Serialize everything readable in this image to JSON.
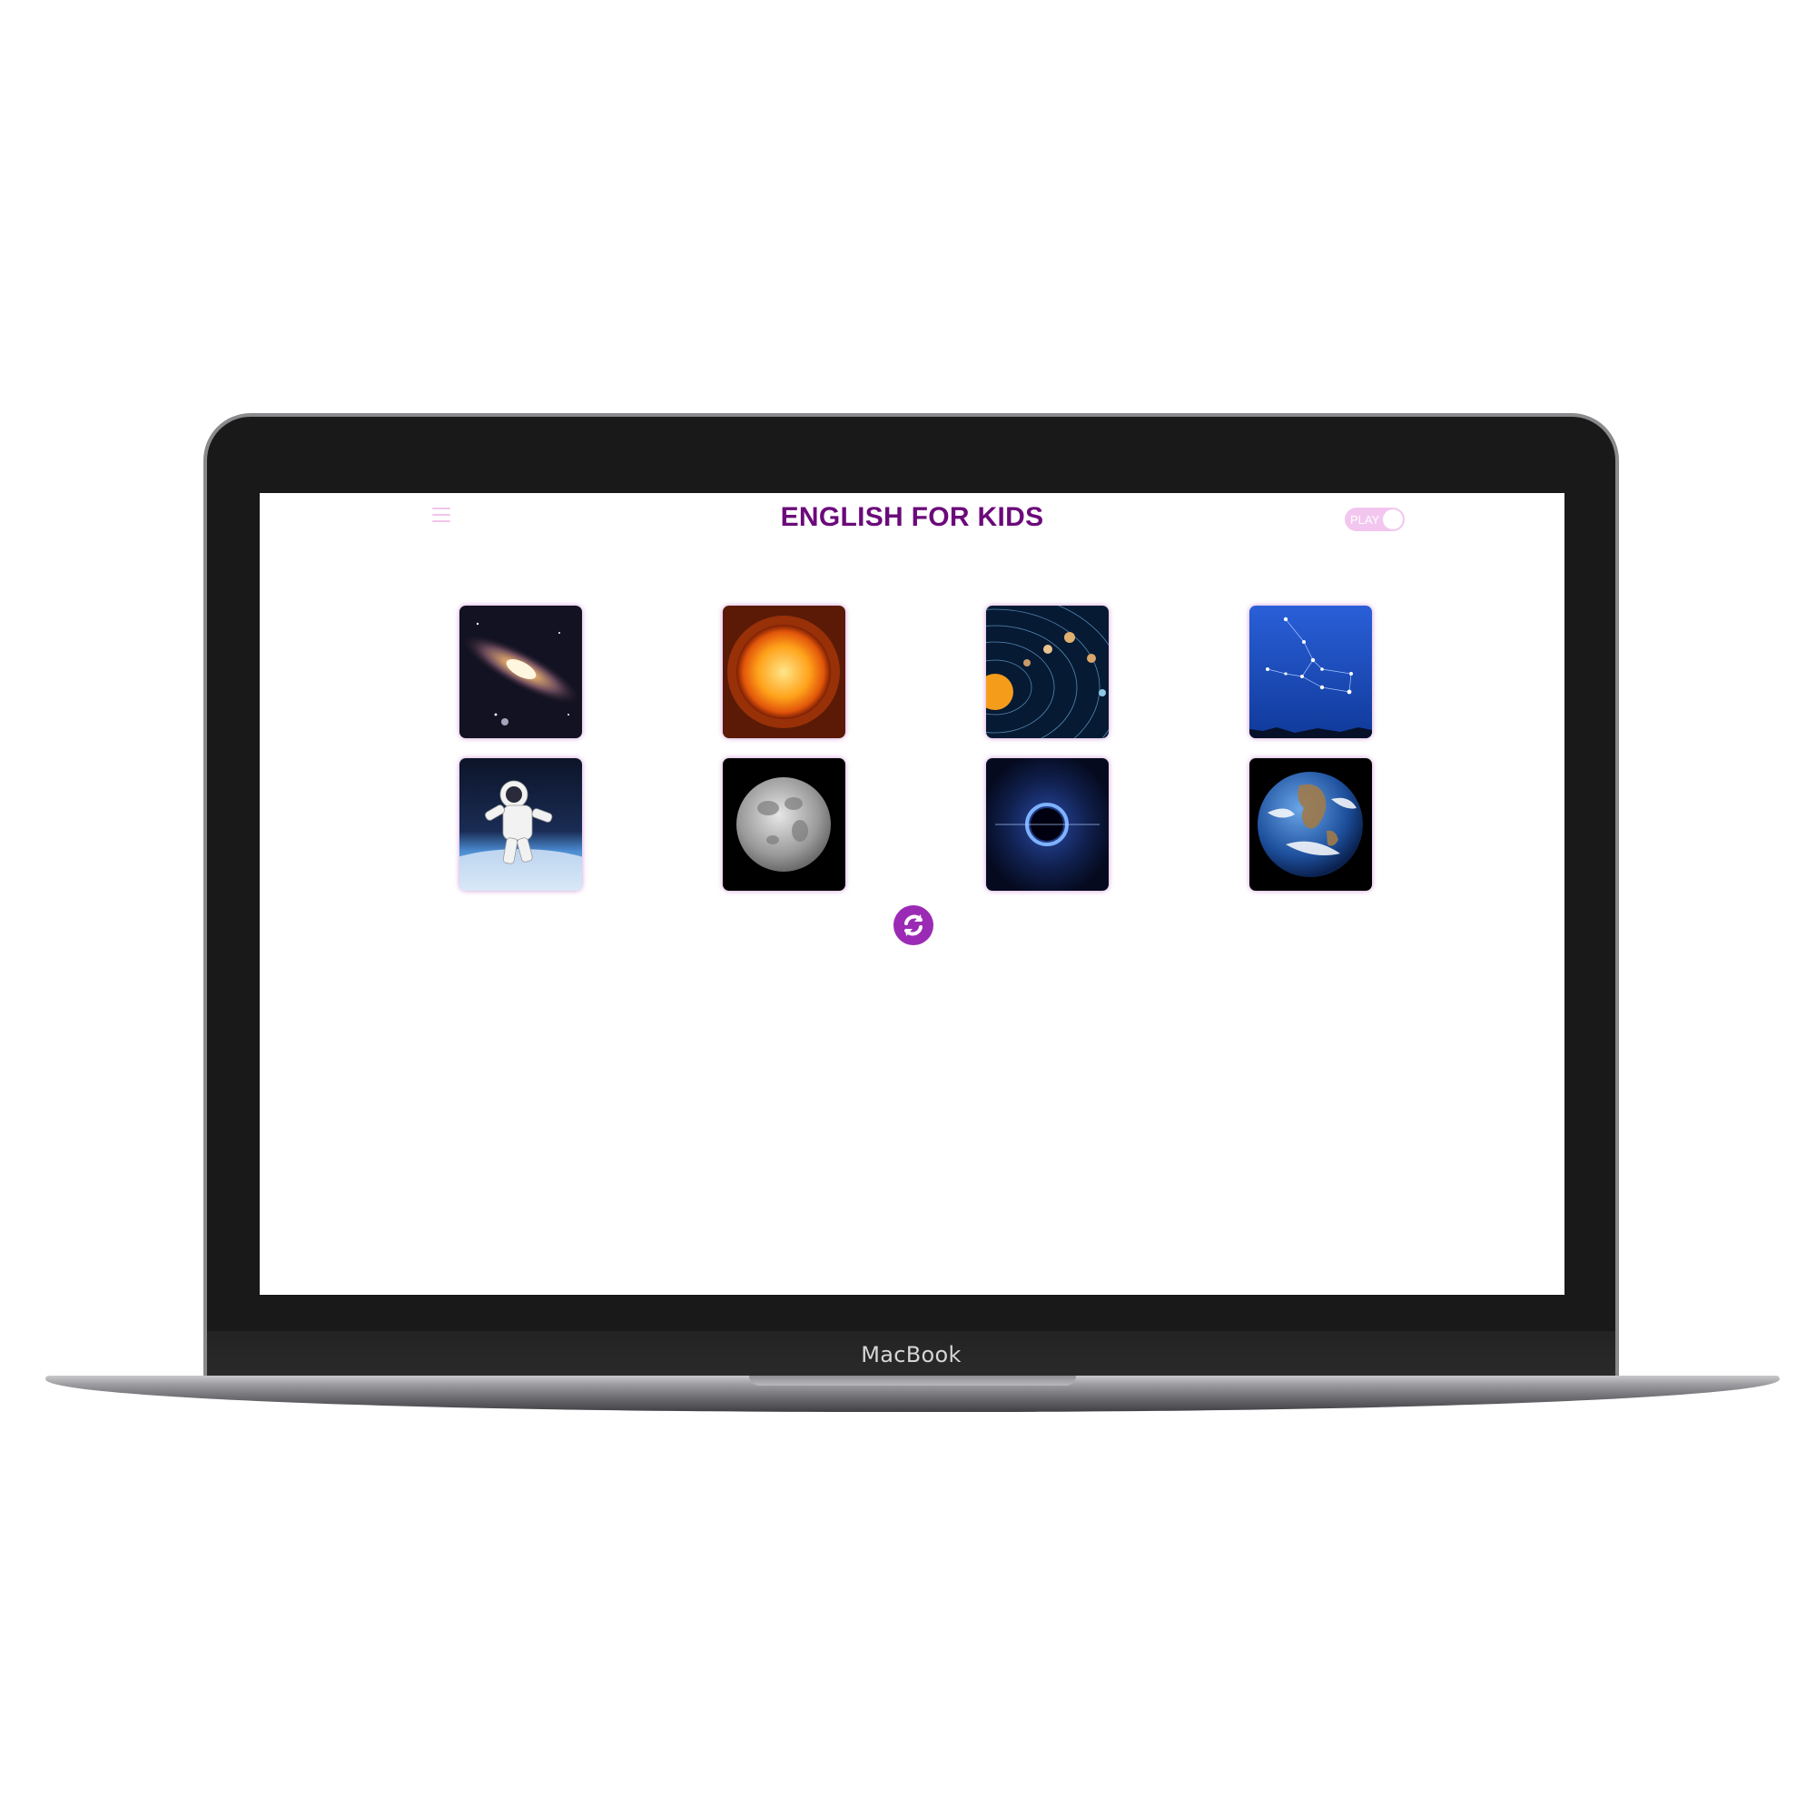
{
  "app": {
    "title": "ENGLISH FOR KIDS",
    "mode_toggle_label": "PLAY",
    "accent_color": "#6b0a7a",
    "toggle_color": "#f3c6ef",
    "refresh_color": "#9b2bb5"
  },
  "cards": [
    {
      "icon": "galaxy-image"
    },
    {
      "icon": "sun-image"
    },
    {
      "icon": "solar-system-image"
    },
    {
      "icon": "constellation-image"
    },
    {
      "icon": "astronaut-image"
    },
    {
      "icon": "moon-image"
    },
    {
      "icon": "black-hole-image"
    },
    {
      "icon": "earth-image"
    }
  ],
  "controls": {
    "refresh_icon": "refresh-icon",
    "menu_icon": "hamburger-menu-icon"
  },
  "device": {
    "brand_label": "MacBook"
  }
}
